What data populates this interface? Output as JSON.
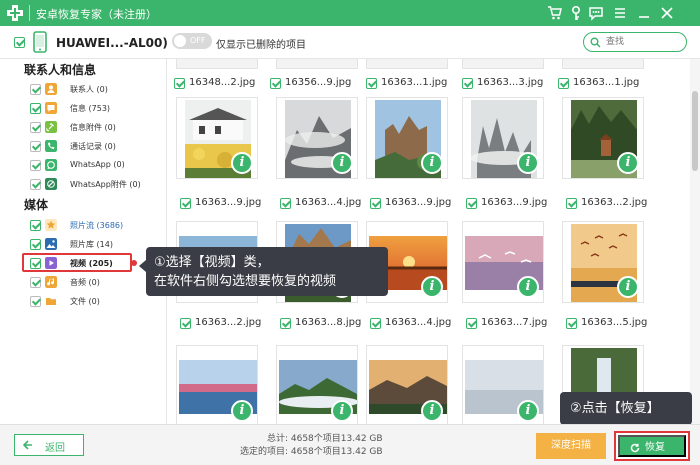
{
  "app": {
    "title": "安卓恢复专家（未注册）"
  },
  "device": {
    "name": "HUAWEI...-AL00)"
  },
  "filter": {
    "toggle_state": "OFF",
    "label": "仅显示已删除的项目"
  },
  "search": {
    "placeholder": "查找"
  },
  "sidebar": {
    "contacts_section": "联系人和信息",
    "media_section": "媒体",
    "contact_items": [
      {
        "label": "联系人 (0)",
        "icon": "contact-icon",
        "color": "#f0a637",
        "checked": false
      },
      {
        "label": "信息 (753)",
        "icon": "message-icon",
        "color": "#f0a637",
        "checked": true
      },
      {
        "label": "信息附件 (0)",
        "icon": "attachment-icon",
        "color": "#7ac142",
        "checked": false
      },
      {
        "label": "通话记录 (0)",
        "icon": "phone-icon",
        "color": "#3bb56b",
        "checked": false
      },
      {
        "label": "WhatsApp (0)",
        "icon": "whatsapp-icon",
        "color": "#3bb56b",
        "checked": false
      },
      {
        "label": "WhatsApp附件 (0)",
        "icon": "whatsapp-attachment-icon",
        "color": "#2e8b57",
        "checked": false
      }
    ],
    "media_items": [
      {
        "label": "照片流 (3686)",
        "icon": "photostream-icon",
        "color": "#f0a637",
        "checked": true
      },
      {
        "label": "照片库 (14)",
        "icon": "gallery-icon",
        "color": "#2b6cb0",
        "checked": true
      },
      {
        "label": "视频 (205)",
        "icon": "video-icon",
        "color": "#8a63d2",
        "checked": true
      },
      {
        "label": "音频 (0)",
        "icon": "audio-icon",
        "color": "#f0a637",
        "checked": false
      },
      {
        "label": "文件 (0)",
        "icon": "folder-icon",
        "color": "#f0a637",
        "checked": false
      }
    ]
  },
  "tooltips": {
    "step1_line1": "①选择【视频】类，",
    "step1_line2": "在软件右侧勾选想要恢复的视频",
    "step2": "②点击【恢复】"
  },
  "grid": {
    "top_row": [
      "16348...2.jpg",
      "16356...9.jpg",
      "16363...1.jpg",
      "16363...3.jpg",
      "16363...1.jpg"
    ],
    "rows": [
      [
        "16363...9.jpg",
        "16363...4.jpg",
        "16363...9.jpg",
        "16363...9.jpg",
        "16363...2.jpg"
      ],
      [
        "16363...2.jpg",
        "16363...8.jpg",
        "16363...4.jpg",
        "16363...7.jpg",
        "16363...5.jpg"
      ],
      [
        "",
        "",
        "",
        "",
        ""
      ]
    ],
    "badge_letter": "i"
  },
  "footer": {
    "back_label": "返回",
    "total_key": "总计:",
    "total_value": "4658个项目13.42 GB",
    "selected_key": "选定的项目:",
    "selected_value": "4658个项目13.42 GB",
    "deep_scan_label": "深度扫描",
    "recover_label": "恢复"
  },
  "colors": {
    "brand": "#3bb56b",
    "highlight": "#e0373a",
    "deep_scan": "#f3b243",
    "tooltip_bg": "#3a3d45"
  }
}
